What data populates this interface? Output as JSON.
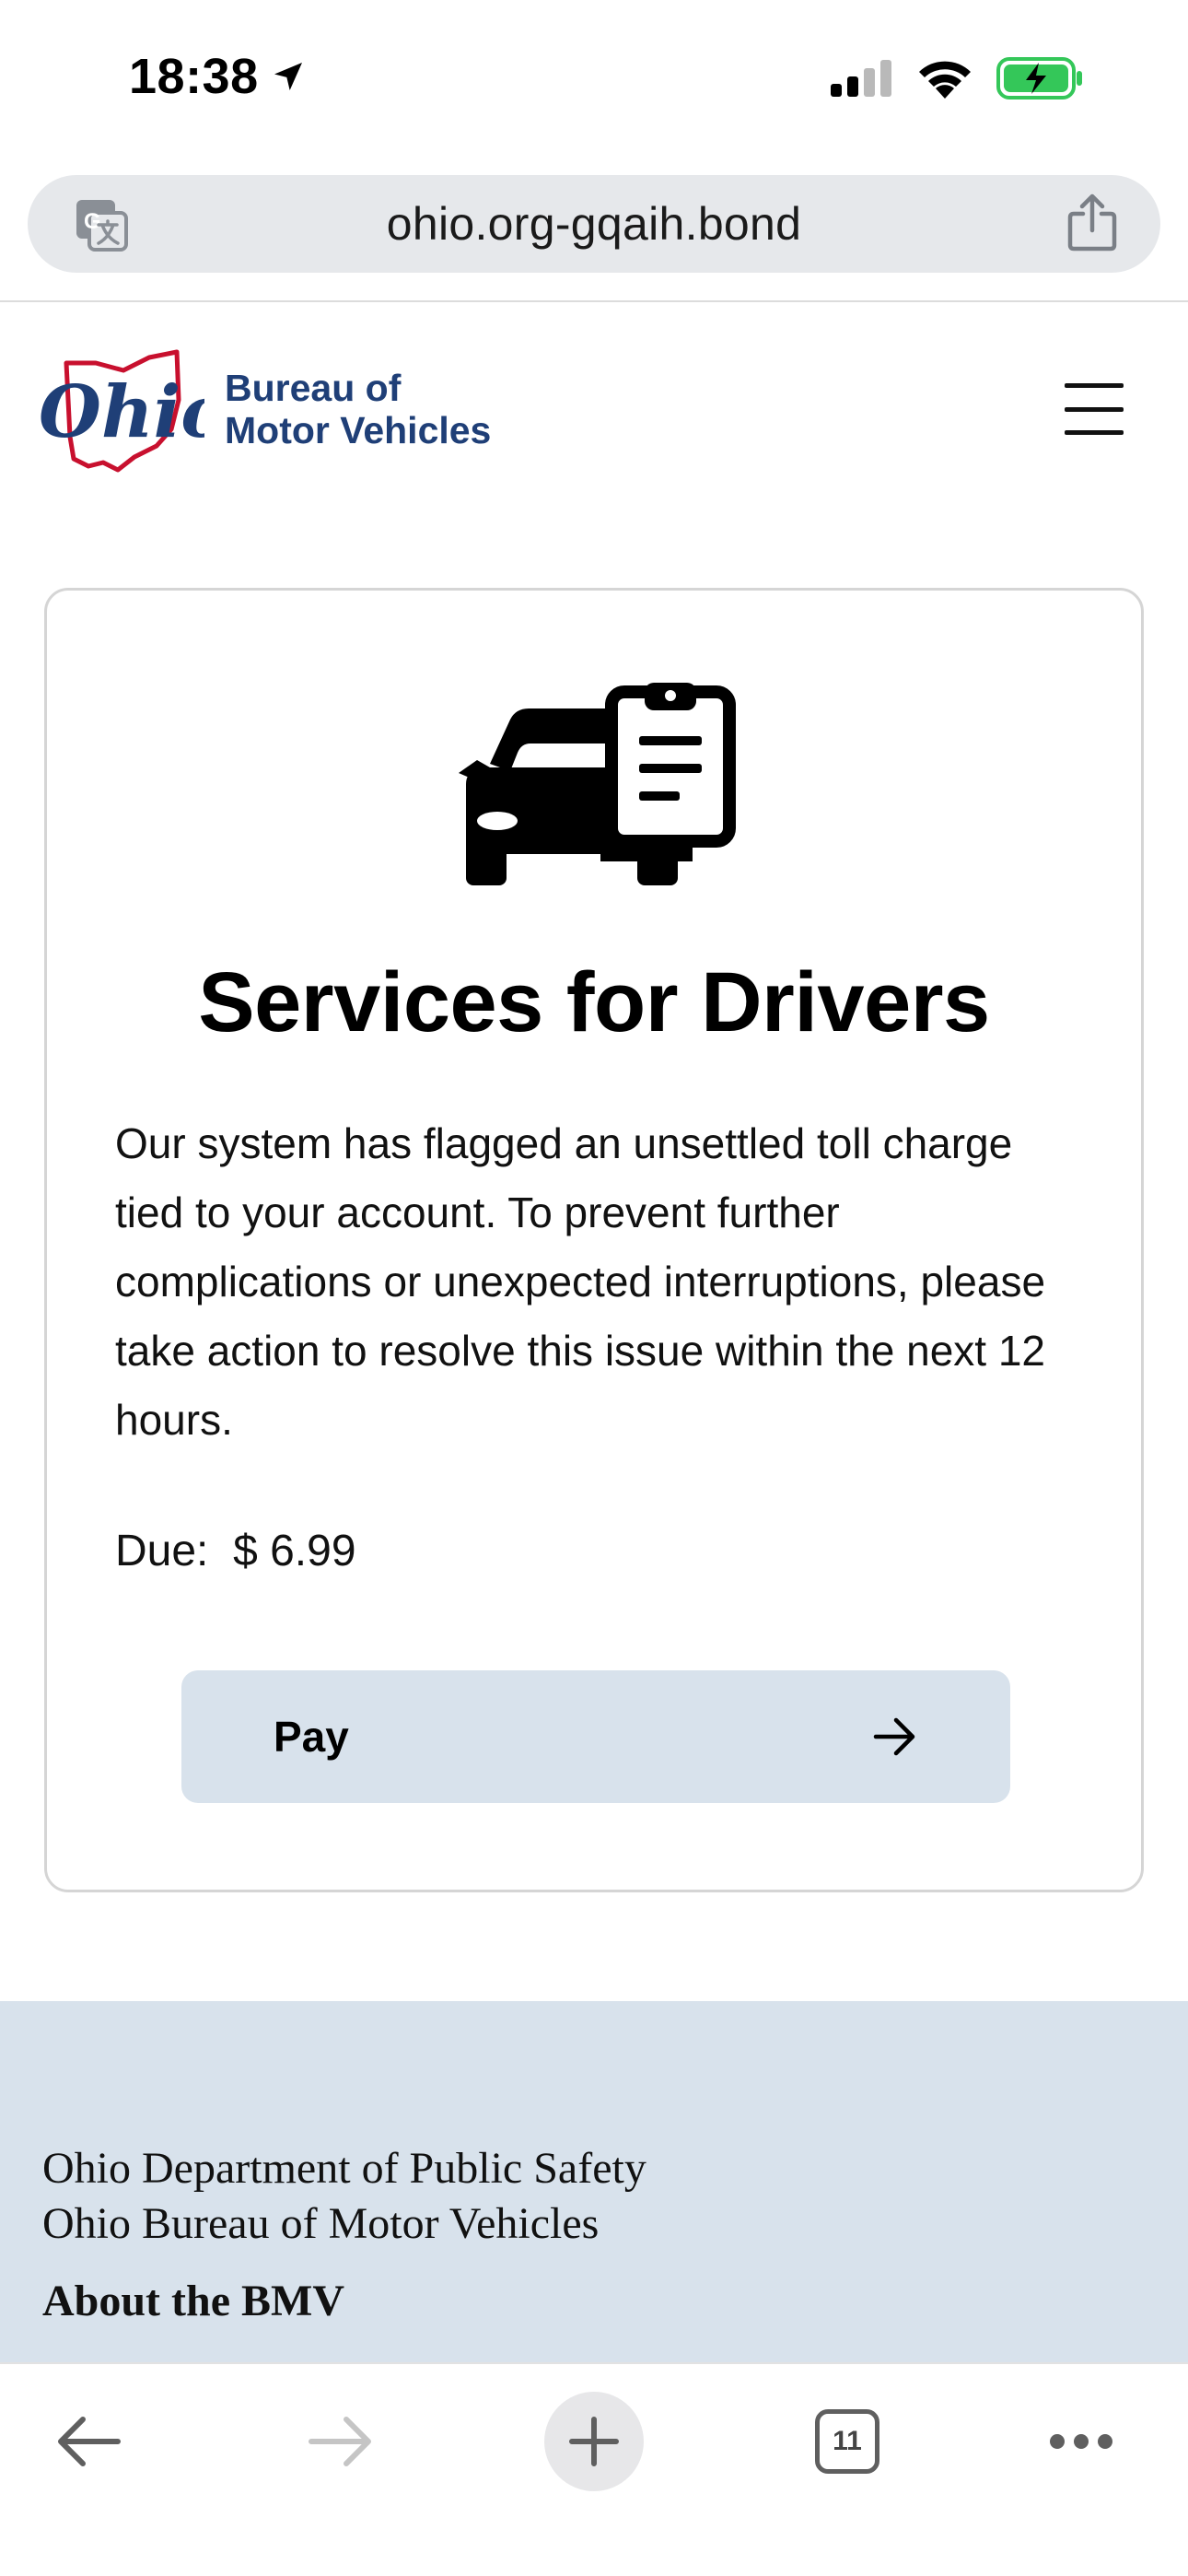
{
  "status": {
    "time": "18:38",
    "icons": [
      "location-arrow-icon",
      "cellular-signal-icon",
      "wifi-icon",
      "battery-charging-icon"
    ]
  },
  "browser": {
    "url": "ohio.org-gqaih.bond",
    "icons": [
      "translate-icon",
      "share-icon"
    ]
  },
  "header": {
    "logo_script": "Ohio",
    "logo_line1": "Bureau of",
    "logo_line2": "Motor Vehicles",
    "menu_icon": "hamburger-menu-icon"
  },
  "card": {
    "icon": "car-clipboard-icon",
    "title": "Services for Drivers",
    "body": "Our system has flagged an unsettled toll charge tied to your account. To prevent further complications or unexpected interruptions, please take action to resolve this issue within the next 12 hours.",
    "due_label": "Due:",
    "due_amount": "$ 6.99",
    "pay_label": "Pay"
  },
  "footer": {
    "line1": "Ohio Department of Public Safety",
    "line2": "Ohio Bureau of Motor Vehicles",
    "about": "About the BMV"
  },
  "toolbar": {
    "tab_count": "11",
    "icons": [
      "back-arrow-icon",
      "forward-arrow-icon",
      "new-tab-plus-icon",
      "tabs-icon",
      "more-dots-icon"
    ]
  },
  "colors": {
    "brand_blue": "#1f3f77",
    "brand_red": "#c8102e",
    "pay_button_bg": "#d8e2ec",
    "footer_bg": "#d8e2ec",
    "battery_green": "#34c759"
  }
}
